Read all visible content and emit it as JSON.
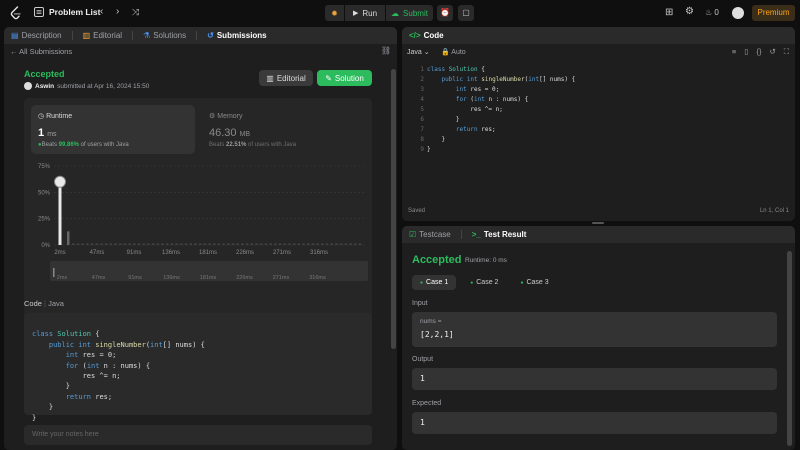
{
  "topbar": {
    "title": "Problem List",
    "run": "Run",
    "submit": "Submit",
    "fire_count": "0",
    "premium": "Premium"
  },
  "left_tabs": [
    "Description",
    "Editorial",
    "Solutions",
    "Submissions"
  ],
  "back_label": "All Submissions",
  "submission": {
    "status": "Accepted",
    "user": "Aswin",
    "submitted": "submitted at Apr 16, 2024 15:50",
    "editorial_btn": "Editorial",
    "solution_btn": "Solution"
  },
  "runtime": {
    "label": "Runtime",
    "value": "1",
    "unit": "ms",
    "beats_prefix": "Beats ",
    "beats_pct": "99.86%",
    "beats_suffix": " of users with Java"
  },
  "memory": {
    "label": "Memory",
    "value": "46.30",
    "unit": "MB",
    "beats_prefix": "Beats ",
    "beats_pct": "22.51%",
    "beats_suffix": " of users with Java"
  },
  "chart_data": {
    "type": "bar",
    "ylabels": [
      "75%",
      "50%",
      "25%",
      "0%"
    ],
    "xlabels": [
      "2ms",
      "47ms",
      "91ms",
      "136ms",
      "181ms",
      "226ms",
      "271ms",
      "316ms"
    ],
    "highlight": "1ms",
    "bars": [
      {
        "x": "1ms",
        "value": 60
      },
      {
        "x": "2ms",
        "value": 13
      }
    ],
    "ylim": [
      0,
      75
    ]
  },
  "code_header": {
    "code": "Code",
    "lang": "Java"
  },
  "notes_placeholder": "Write your notes here",
  "right_code": {
    "tab": "Code",
    "lang": "Java",
    "mode": "Auto",
    "status": "Saved",
    "cursor": "Ln 1, Col 1"
  },
  "code_lines": [
    "class Solution {",
    "    public int singleNumber(int[] nums) {",
    "        int res = 0;",
    "        for (int n : nums) {",
    "            res ^= n;",
    "        }",
    "        return res;",
    "    }",
    "}"
  ],
  "test_tabs": {
    "testcase": "Testcase",
    "result": "Test Result"
  },
  "result": {
    "status": "Accepted",
    "runtime": "Runtime: 0 ms",
    "cases": [
      "Case 1",
      "Case 2",
      "Case 3"
    ],
    "input_label": "Input",
    "input_name": "nums =",
    "input_value": "[2,2,1]",
    "output_label": "Output",
    "output_value": "1",
    "expected_label": "Expected",
    "expected_value": "1"
  },
  "colors": {
    "accent": "#2cbb5d",
    "premium": "#ffa116",
    "blue": "#569cd6"
  }
}
